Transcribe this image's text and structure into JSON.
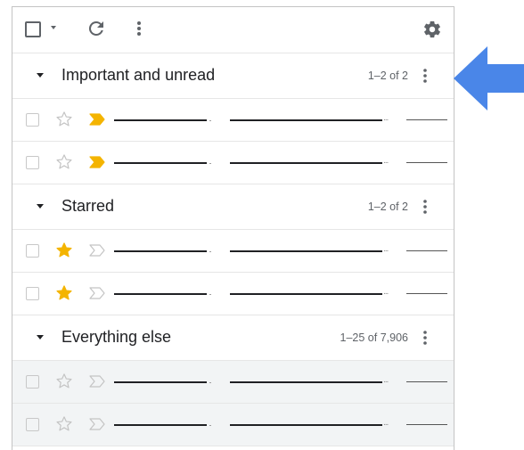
{
  "colors": {
    "accent_arrow": "#4a86e8",
    "important_marker": "#f4b400",
    "starred": "#f4b400",
    "icon_gray": "#5f6368",
    "divider": "#e6e6e6",
    "gray_row_bg": "#f2f4f5"
  },
  "toolbar": {
    "icons": [
      "select-all-checkbox",
      "select-dropdown-icon",
      "refresh-icon",
      "more-vert-icon",
      "settings-gear-icon"
    ]
  },
  "sections": [
    {
      "title": "Important and unread",
      "count": "1–2 of 2",
      "rows": [
        {
          "starred": false,
          "important": true,
          "dots": "..."
        },
        {
          "starred": false,
          "important": true,
          "dots": "..."
        }
      ]
    },
    {
      "title": "Starred",
      "count": "1–2 of 2",
      "rows": [
        {
          "starred": true,
          "important": false,
          "dots": "..."
        },
        {
          "starred": true,
          "important": false,
          "dots": "..."
        }
      ]
    },
    {
      "title": "Everything else",
      "count": "1–25 of 7,906",
      "rows": [
        {
          "starred": false,
          "important": false,
          "dots": "..."
        },
        {
          "starred": false,
          "important": false,
          "dots": "..."
        }
      ]
    }
  ],
  "annotation": {
    "icon": "arrow-left-icon"
  }
}
